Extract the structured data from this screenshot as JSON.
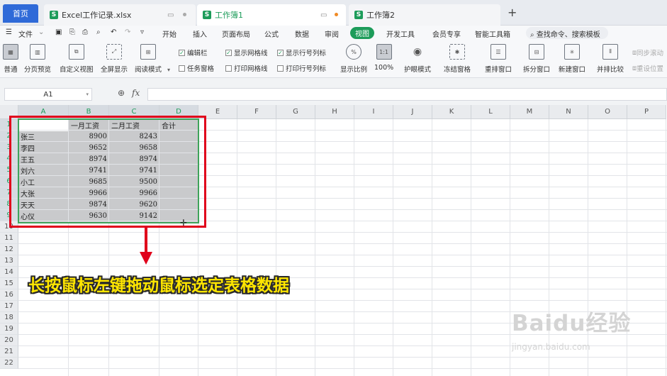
{
  "tabs": {
    "home": "首页",
    "doc1": "Excel工作记录.xlsx",
    "doc2": "工作簿1",
    "doc3": "工作簿2",
    "new": "+"
  },
  "menu": {
    "file": "文件",
    "items": [
      "开始",
      "插入",
      "页面布局",
      "公式",
      "数据",
      "审阅",
      "视图",
      "开发工具",
      "会员专享",
      "智能工具箱"
    ],
    "active": "视图",
    "search": "查找命令、搜索模板"
  },
  "ribbon": {
    "buttons": [
      "普通",
      "分页预览",
      "自定义视图",
      "全屏显示",
      "阅读模式",
      "显示比例",
      "100%",
      "护眼模式",
      "冻结窗格",
      "重排窗口",
      "拆分窗口",
      "新建窗口",
      "并排比较"
    ],
    "checks": {
      "edit_bar": "编辑栏",
      "show_grid": "显示网格线",
      "show_headers": "显示行号列标",
      "task_pane": "任务窗格",
      "print_grid": "打印网格线",
      "print_headers": "打印行号列标"
    },
    "sync_scroll": "同步滚动",
    "reset_pos": "重设位置"
  },
  "formula": {
    "name_box": "A1",
    "fx": "fx"
  },
  "grid": {
    "columns": [
      "A",
      "B",
      "C",
      "D",
      "E",
      "F",
      "G",
      "H",
      "I",
      "J",
      "K",
      "L",
      "M",
      "N",
      "O",
      "P"
    ],
    "rows": [
      "1",
      "2",
      "3",
      "4",
      "5",
      "6",
      "7",
      "8",
      "9",
      "10",
      "11",
      "12",
      "13",
      "14",
      "15",
      "16",
      "17",
      "18",
      "19",
      "20",
      "21",
      "22"
    ],
    "headers": [
      "",
      "一月工资",
      "二月工资",
      "合计"
    ],
    "data": [
      [
        "张三",
        "8900",
        "8243"
      ],
      [
        "李四",
        "9652",
        "9658"
      ],
      [
        "王五",
        "8974",
        "8974"
      ],
      [
        "刘六",
        "9741",
        "9741"
      ],
      [
        "小工",
        "9685",
        "9500"
      ],
      [
        "大张",
        "9966",
        "9966"
      ],
      [
        "天天",
        "9874",
        "9620"
      ],
      [
        "心仪",
        "9630",
        "9142"
      ]
    ]
  },
  "caption": "长按鼠标左键拖动鼠标选定表格数据",
  "watermark": {
    "brand": "Baidu经验",
    "url": "jingyan.baidu.com"
  },
  "colors": {
    "accent": "#1d9c5a",
    "annotation": "#e0001b",
    "caption": "#ffe600"
  }
}
